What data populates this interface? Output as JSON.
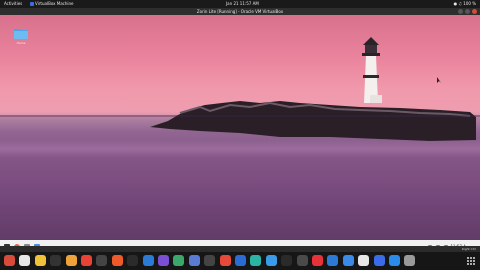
{
  "topbar": {
    "activities": "Activities",
    "app_menu": "VirtualBox Machine",
    "clock": "Jan 21  11:57 AM",
    "battery": "100 %"
  },
  "vm_window": {
    "title": "Zorin Lite [Running] - Oracle VM VirtualBox"
  },
  "desktop": {
    "folder_label": "Home",
    "wallpaper_colors": [
      "#e9829c",
      "#f199ac",
      "#8a5a8a",
      "#5b3660"
    ]
  },
  "guest_taskbar": {
    "clock": "11:57 A",
    "apps": [
      "zorin-menu-icon",
      "firefox-icon",
      "files-icon",
      "terminal-icon"
    ]
  },
  "host_status": {
    "right_key": "Right Ctrl"
  },
  "dock": {
    "apps": [
      {
        "name": "zorin-app-icon",
        "color": "#d84a3a"
      },
      {
        "name": "files-app-icon",
        "color": "#e8e8e8"
      },
      {
        "name": "dash-app-icon",
        "color": "#f0c23a"
      },
      {
        "name": "terminal-app-icon",
        "color": "#333333"
      },
      {
        "name": "folder-app-icon",
        "color": "#f0a23a"
      },
      {
        "name": "chrome-app-icon",
        "color": "#e94335"
      },
      {
        "name": "settings-app-icon",
        "color": "#444444"
      },
      {
        "name": "brave-app-icon",
        "color": "#ef5a2a"
      },
      {
        "name": "vim-app-icon",
        "color": "#2b2b2b"
      },
      {
        "name": "vscode-app-icon",
        "color": "#2b7bd4"
      },
      {
        "name": "rider-app-icon",
        "color": "#7b4fd4"
      },
      {
        "name": "photos-app-icon",
        "color": "#3aa86b"
      },
      {
        "name": "virtualbox-app-icon",
        "color": "#5a7bd4"
      },
      {
        "name": "apps-app-icon",
        "color": "#444444"
      },
      {
        "name": "calendar-app-icon",
        "color": "#e84a3a"
      },
      {
        "name": "rdp-app-icon",
        "color": "#2b6cd4"
      },
      {
        "name": "browser-app-icon",
        "color": "#2bb4a4"
      },
      {
        "name": "telegram-app-icon",
        "color": "#3a9be8"
      },
      {
        "name": "spotify-app-icon",
        "color": "#2a2a2a"
      },
      {
        "name": "editor-app-icon",
        "color": "#4a4a4a"
      },
      {
        "name": "opera-app-icon",
        "color": "#e8323a"
      },
      {
        "name": "chat-app-icon",
        "color": "#2b7bd4"
      },
      {
        "name": "mail-app-icon",
        "color": "#3a8be8"
      },
      {
        "name": "store-app-icon",
        "color": "#e8e8e8"
      },
      {
        "name": "monitor-app-icon",
        "color": "#3a6be8"
      },
      {
        "name": "remote-app-icon",
        "color": "#2b8be8"
      },
      {
        "name": "trash-app-icon",
        "color": "#9a9a9a"
      }
    ]
  }
}
